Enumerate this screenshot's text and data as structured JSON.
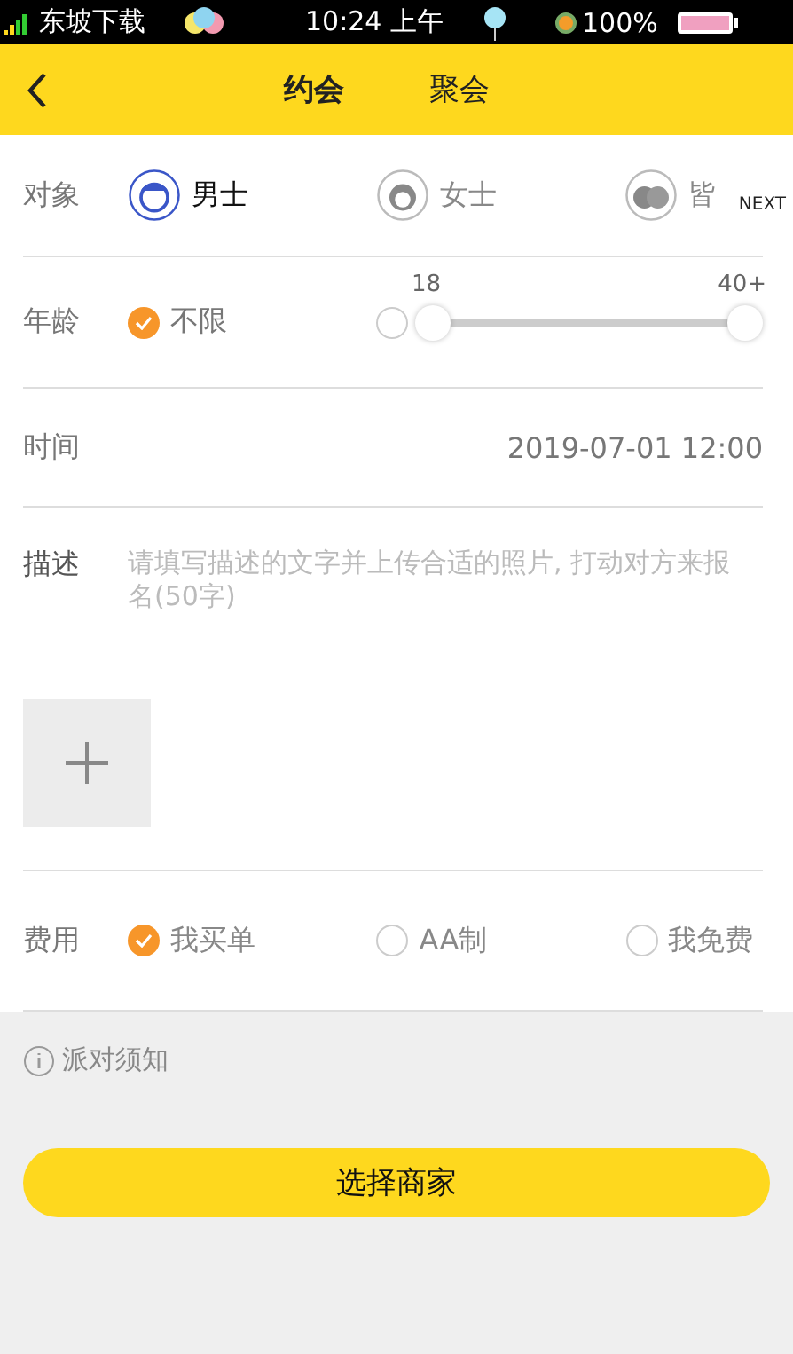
{
  "status_bar": {
    "carrier": "东坡下载",
    "time": "10:24 上午",
    "battery": "100%"
  },
  "header": {
    "tabs": [
      {
        "label": "约会",
        "selected": true
      },
      {
        "label": "聚会",
        "selected": false
      }
    ]
  },
  "target": {
    "label": "对象",
    "options": [
      {
        "label": "男士",
        "kind": "male",
        "selected": true
      },
      {
        "label": "女士",
        "kind": "female",
        "selected": false
      },
      {
        "label": "皆",
        "kind": "both",
        "selected": false
      }
    ],
    "overlay": "NEXT"
  },
  "age": {
    "label": "年龄",
    "unlimited": {
      "label": "不限",
      "selected": true
    },
    "custom": {
      "selected": false
    },
    "min_label": "18",
    "max_label": "40+",
    "low": {
      "level": 0
    },
    "high": {
      "level": 1
    }
  },
  "time": {
    "label": "时间",
    "value": "2019-07-01 12:00"
  },
  "description": {
    "label": "描述",
    "placeholder": "请填写描述的文字并上传合适的照片, 打动对方来报名(50字)"
  },
  "fee": {
    "label": "费用",
    "options": [
      {
        "label": "我买单",
        "selected": true
      },
      {
        "label": "AA制",
        "selected": false
      },
      {
        "label": "我免费",
        "selected": false
      }
    ]
  },
  "notice": "派对须知",
  "submit": "选择商家"
}
